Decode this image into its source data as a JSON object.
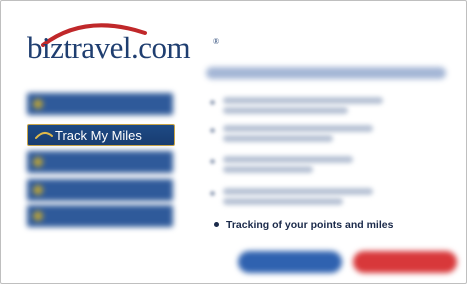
{
  "logo": {
    "text": "biztravel.com",
    "reg_mark": "®",
    "accent_color": "#c0282a",
    "text_color": "#1f3e70"
  },
  "sidebar": {
    "active_item": {
      "label": "Track My Miles",
      "icon": "arc-icon"
    },
    "colors": {
      "button": "#2f5a9a",
      "active_border": "#c9a548"
    }
  },
  "content": {
    "visible_bullet": "Tracking of your points and miles"
  },
  "buttons": {
    "colors": {
      "primary": "#2f62b0",
      "secondary": "#d8383a"
    }
  }
}
